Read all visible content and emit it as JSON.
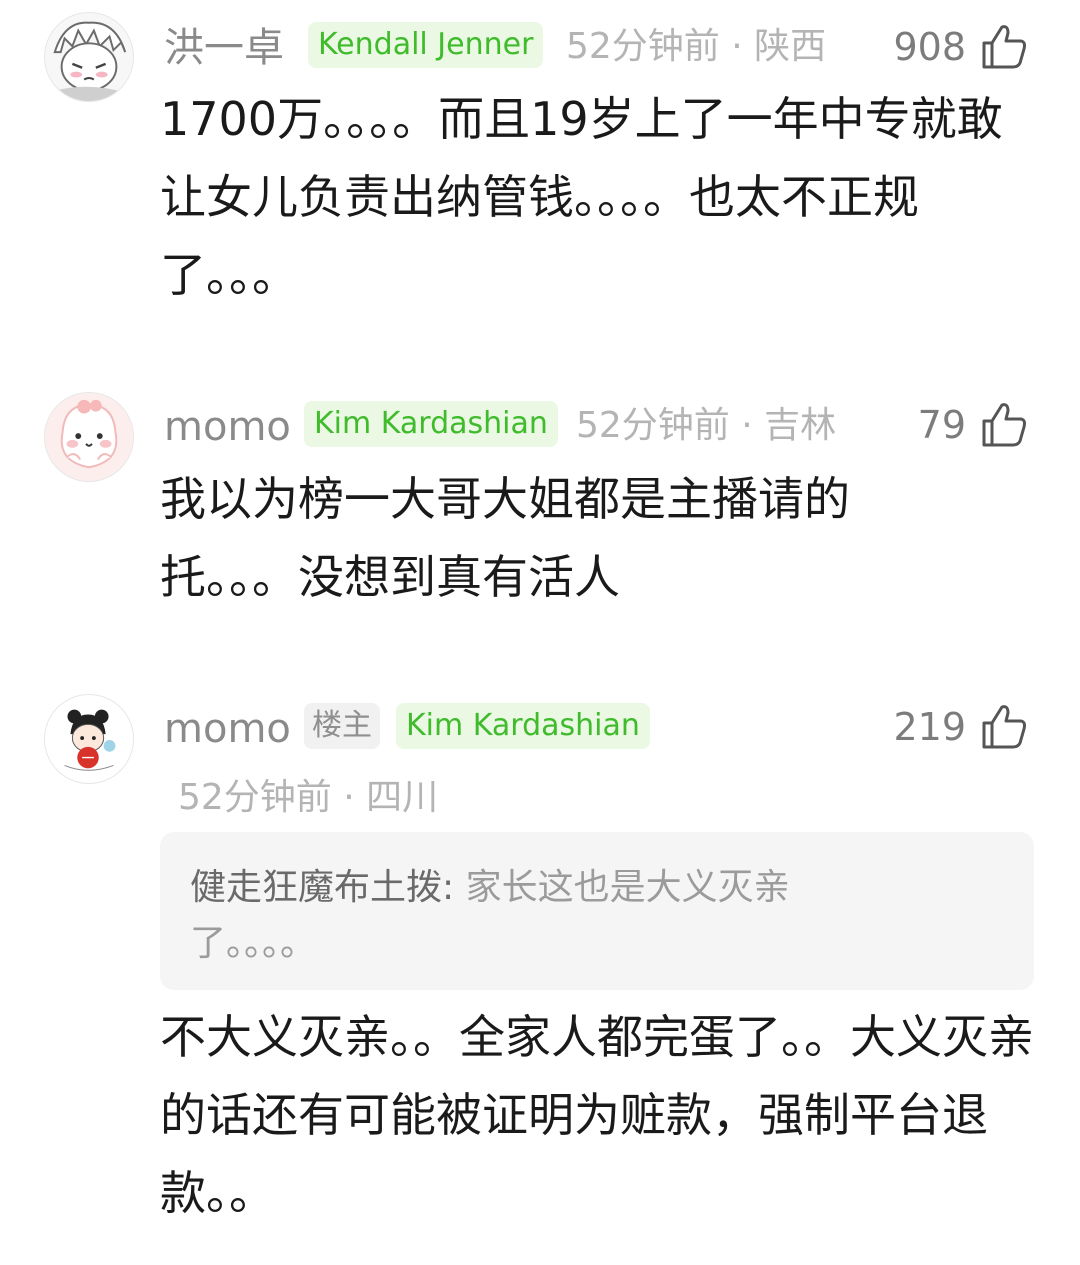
{
  "comments": [
    {
      "username": "洪一卓",
      "badge": "Kendall Jenner",
      "time": "52分钟前",
      "location": "陕西",
      "likes": "908",
      "text": "1700万。。。。而且19岁上了一年中专就敢让女儿负责出纳管钱。。。。也太不正规了。。。"
    },
    {
      "username": "momo",
      "badge": "Kim Kardashian",
      "time": "52分钟前",
      "location": "吉林",
      "likes": "79",
      "text_line1": "我以为榜一大哥大姐都是主播请的",
      "text_line2": "托。。。没想到真有活人"
    },
    {
      "username": "momo",
      "op_badge": "楼主",
      "badge": "Kim Kardashian",
      "time": "52分钟前",
      "location": "四川",
      "likes": "219",
      "quote": {
        "author": "健走狂魔布土拨",
        "text": "家长这也是大义灭亲了。。。。"
      },
      "text": "不大义灭亲。。全家人都完蛋了。。大义灭亲的话还有可能被证明为赃款，强制平台退款。。"
    }
  ],
  "icons": {
    "like": "thumbs-up-icon",
    "separator": "·"
  }
}
